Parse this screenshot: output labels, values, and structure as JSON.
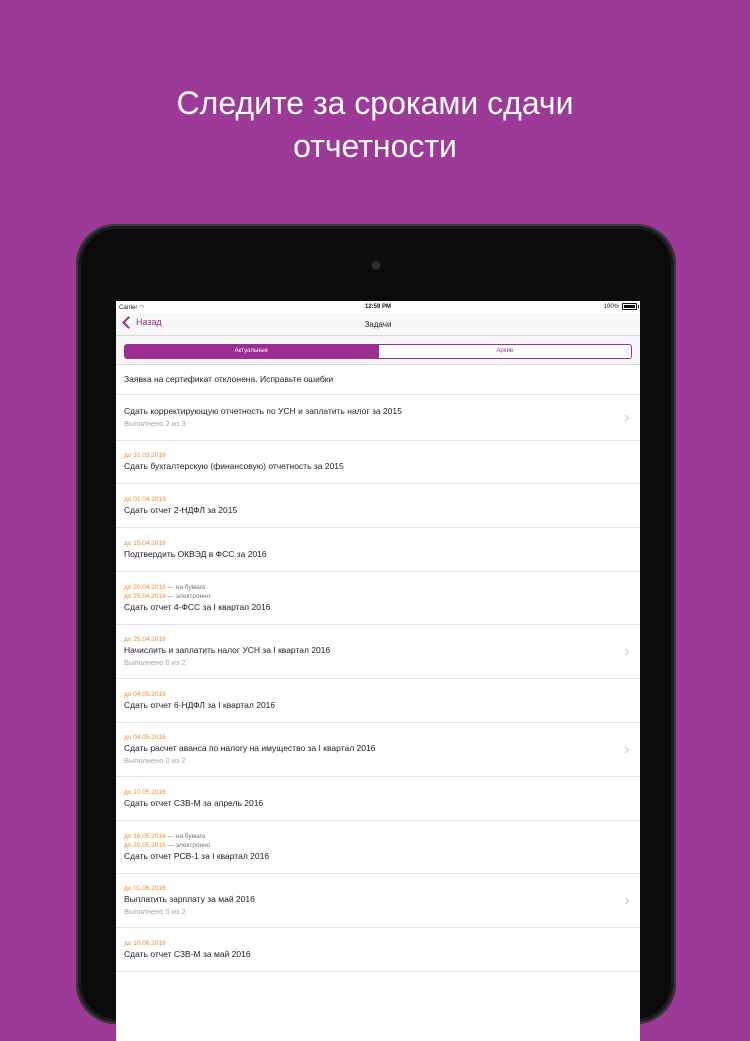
{
  "headline": {
    "line1": "Следите за сроками сдачи",
    "line2": "отчетности"
  },
  "colors": {
    "background": "#9d3a98",
    "accent": "#9a2f8f",
    "due": "#ef8b2c"
  },
  "statusbar": {
    "carrier": "Carrier",
    "time": "12:59 PM",
    "battery": "100%"
  },
  "navbar": {
    "back_label": "Назад",
    "title": "Задачи"
  },
  "segments": [
    "Актуальные",
    "Архив"
  ],
  "tasks": [
    {
      "title": "Заявка на сертификат отклонена. Исправьте ошибки"
    },
    {
      "title": "Сдать корректирующую отчетность по УСН и заплатить налог за 2015",
      "progress": "Выполнено 2 из 3"
    },
    {
      "due1": "до 31.03.2016",
      "title": "Сдать бухгалтерскую (финансовую) отчетность за 2015"
    },
    {
      "due1": "до 01.04.2016",
      "title": "Сдать отчет 2-НДФЛ за 2015"
    },
    {
      "due1": "до 15.04.2016",
      "title": "Подтвердить ОКВЭД в ФСС за 2016"
    },
    {
      "due1": "до 20.04.2016",
      "note1": " — на бумаге",
      "due2": "до 25.04.2016",
      "note2": " — электронно",
      "title": "Сдать отчет 4-ФСС за  I квартал 2016"
    },
    {
      "due1": "до 25.04.2016",
      "title": "Начислить и заплатить налог УСН за I квартал 2016",
      "progress": "Выполнено 0 из 2"
    },
    {
      "due1": "до 04.05.2016",
      "title": "Сдать отчет 6-НДФЛ за I квартал 2016"
    },
    {
      "due1": "до 04.05.2016",
      "title": "Сдать расчет аванса по налогу на имущество за I квартал 2016",
      "progress": "Выполнено 0 из 2"
    },
    {
      "due1": "до 10.05.2016",
      "title": "Сдать отчет СЗВ-М за апрель 2016"
    },
    {
      "due1": "до 16.05.2016",
      "note1": " — на бумаге",
      "due2": "до 20.05.2016",
      "note2": " — электронно",
      "title": "Сдать отчет РСВ-1 за I квартал 2016"
    },
    {
      "due1": "до 01.06.2016",
      "title": "Выплатить зарплату за май 2016",
      "progress": "Выполнено 0 из 2"
    },
    {
      "due1": "до 10.06.2016",
      "title": "Сдать отчет СЗВ-М за май 2016"
    }
  ]
}
